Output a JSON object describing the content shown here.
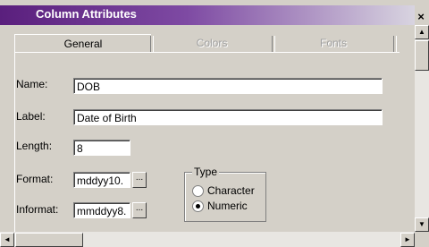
{
  "window": {
    "title": "Column Attributes",
    "close_glyph": "×"
  },
  "tabs": [
    {
      "label": "General",
      "active": true
    },
    {
      "label": "Colors",
      "active": false
    },
    {
      "label": "Fonts",
      "active": false
    }
  ],
  "form": {
    "name": {
      "label": "Name:",
      "value": "DOB"
    },
    "label": {
      "label": "Label:",
      "value": "Date of Birth"
    },
    "length": {
      "label": "Length:",
      "value": "8"
    },
    "format": {
      "label": "Format:",
      "value": "mddyy10.",
      "button": "..."
    },
    "informat": {
      "label": "Informat:",
      "value": "mmddyy8.",
      "button": "..."
    }
  },
  "type_group": {
    "title": "Type",
    "options": [
      {
        "label": "Character",
        "selected": false
      },
      {
        "label": "Numeric",
        "selected": true
      }
    ]
  },
  "scroll": {
    "up": "▲",
    "down": "▼",
    "left": "◄",
    "right": "►"
  }
}
